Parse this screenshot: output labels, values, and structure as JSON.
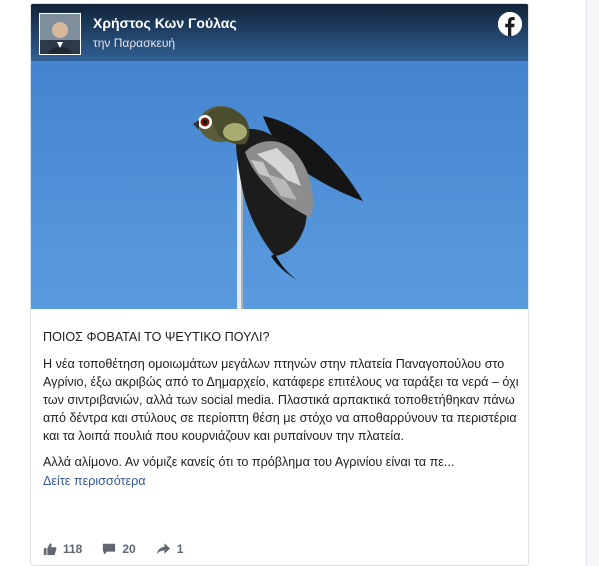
{
  "post": {
    "author": "Χρήστος Κων Γούλας",
    "timestamp": "την Παρασκευή",
    "title": "ΠΟΙΟΣ ΦΟΒΑΤΑΙ ΤΟ ΨΕΥΤΙΚΟ ΠΟΥΛΙ?",
    "paragraph1": "Η νέα τοποθέτηση ομοιωμάτων μεγάλων πτηνών στην πλατεία Παναγοπούλου στο Αγρίνιο, έξω ακριβώς από το Δημαρχείο, κατάφερε επιτέλους να ταράξει τα νερά – όχι των σιντριβανιών, αλλά των social media. Πλαστικά αρπακτικά τοποθετήθηκαν πάνω από δέντρα και στύλους σε περίοπτη θέση με στόχο να αποθαρρύνουν τα περιστέρια και τα λοιπά πουλιά που κουρνιάζουν και ρυπαίνουν την πλατεία.",
    "paragraph2": "Αλλά αλίμονο. Αν νόμιζε κανείς ότι το πρόβλημα του Αγρινίου είναι τα πε...",
    "see_more": "Δείτε περισσότερα"
  },
  "stats": {
    "likes": "118",
    "comments": "20",
    "shares": "1"
  },
  "icons": {
    "brand": "facebook-icon",
    "like": "thumbs-up-icon",
    "comment": "comment-icon",
    "share": "share-arrow-icon"
  },
  "colors": {
    "link": "#385898",
    "sky": "#4e8ed6",
    "facebook": "#1877f2",
    "stat_text": "#606770"
  }
}
